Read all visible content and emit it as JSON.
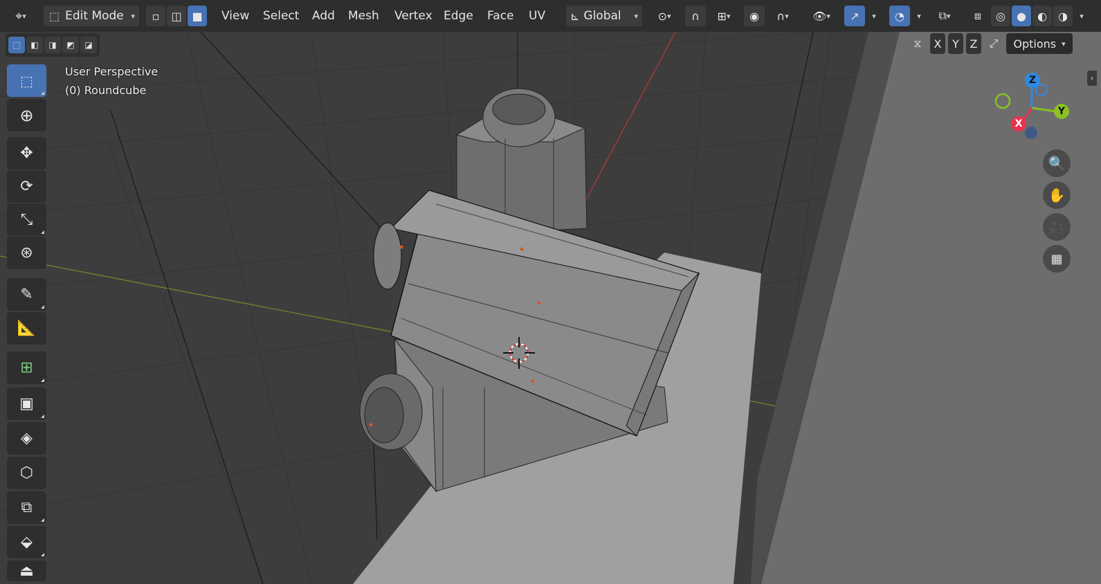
{
  "topbar": {
    "mode_label": "Edit Mode",
    "menus": [
      "View",
      "Select",
      "Add",
      "Mesh",
      "Vertex",
      "Edge",
      "Face",
      "UV"
    ],
    "orientation_label": "Global"
  },
  "header_row2": {
    "axis_x": "X",
    "axis_y": "Y",
    "axis_z": "Z",
    "options_label": "Options"
  },
  "viewport": {
    "view_name": "User Perspective",
    "object_name": "(0) Roundcube"
  },
  "gizmo": {
    "x": "X",
    "y": "Y",
    "z": "Z",
    "colors": {
      "x": "#e8324e",
      "y": "#8bc122",
      "z": "#2f8ae6"
    }
  },
  "toolbar": {
    "tools": [
      "select-box-tool",
      "cursor-tool",
      "move-tool",
      "rotate-tool",
      "scale-tool",
      "transform-tool",
      "annotate-tool",
      "measure-tool",
      "add-cube-tool",
      "extrude-tool",
      "inset-tool",
      "bevel-tool",
      "loop-cut-tool",
      "knife-tool",
      "poly-build-tool"
    ]
  },
  "colors": {
    "accent": "#4772b3",
    "header_bg": "#2d2d2d",
    "viewport_bg": "#3d3d3d"
  }
}
